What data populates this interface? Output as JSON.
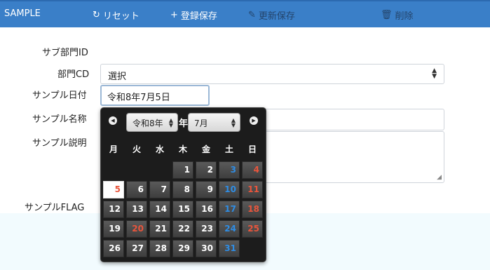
{
  "toolbar": {
    "app_name": "SAMPLE",
    "reset_label": "リセット",
    "register_label": "登録保存",
    "update_label": "更新保存",
    "delete_label": "削除"
  },
  "form": {
    "sub_dept_id_label": "サブ部門ID",
    "dept_cd_label": "部門CD",
    "dept_cd_value": "選択",
    "sample_date_label": "サンプル日付",
    "sample_date_value": "令和8年7月5日",
    "sample_name_label": "サンプル名称",
    "sample_desc_label": "サンプル説明",
    "sample_flag_label": "サンプルFLAG"
  },
  "calendar": {
    "year_value": "令和8年",
    "year_suffix": "年",
    "month_value": "7月",
    "weekdays": [
      "月",
      "火",
      "水",
      "木",
      "金",
      "土",
      "日"
    ],
    "first_weekday_index": 3,
    "days_in_month": 31,
    "selected_day": 5,
    "holidays": [
      20
    ],
    "colors": {
      "saturday": "#2f8de4",
      "sunday": "#e9553c"
    }
  }
}
